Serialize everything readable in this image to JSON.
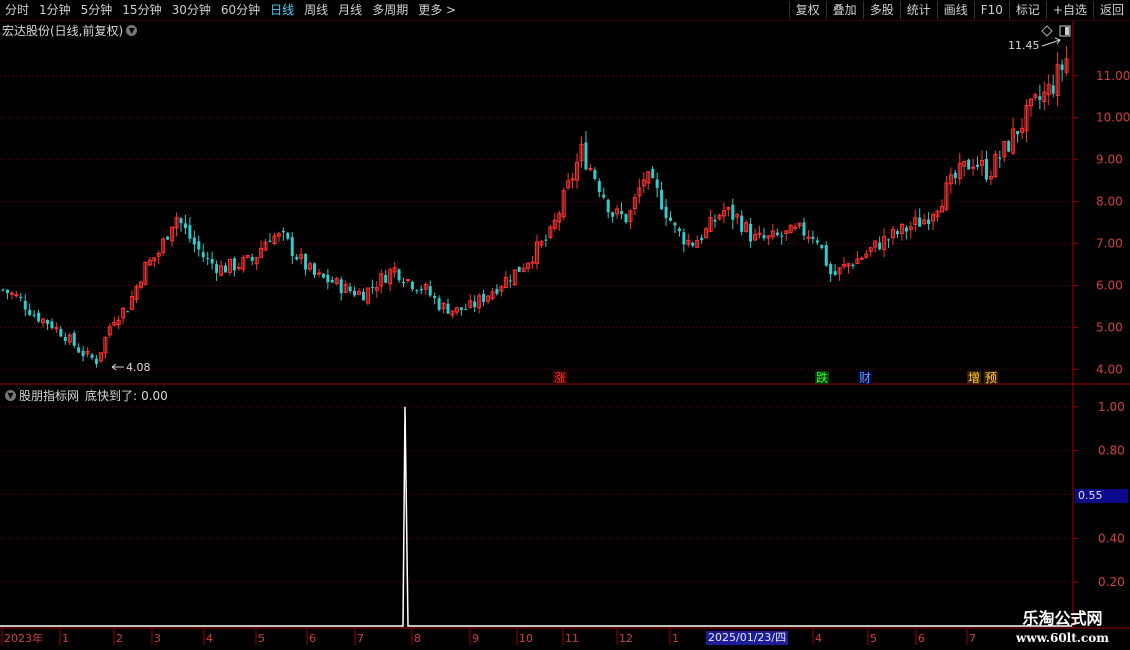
{
  "toolbar": {
    "periods": [
      "分时",
      "1分钟",
      "5分钟",
      "15分钟",
      "30分钟",
      "60分钟",
      "日线",
      "周线",
      "月线",
      "多周期",
      "更多"
    ],
    "active_period": "日线",
    "more_arrow": ">",
    "right_buttons": [
      "复权",
      "叠加",
      "多股",
      "统计",
      "画线",
      "F10",
      "标记",
      "+自选",
      "返回"
    ]
  },
  "main_panel": {
    "title": "宏达股份(日线,前复权)",
    "price_axis": [
      "11.00",
      "10.00",
      "9.00",
      "8.00",
      "7.00",
      "6.00",
      "5.00",
      "4.00"
    ],
    "high_label": "11.45",
    "low_label": "4.08",
    "event_tags": [
      {
        "text": "涨",
        "color": "#ff3030",
        "bg": "#3a0000"
      },
      {
        "text": "跌",
        "color": "#30ff30",
        "bg": "#003a00"
      },
      {
        "text": "财",
        "color": "#5aa0ff",
        "bg": "#000030"
      },
      {
        "text": "增",
        "color": "#ffcc33",
        "bg": "#3a2000"
      },
      {
        "text": "预",
        "color": "#ffcc33",
        "bg": "#3a2000"
      }
    ]
  },
  "sub_panel": {
    "title": "股朋指标网",
    "indicator_label": "底快到了:",
    "indicator_value": "0.00",
    "axis": [
      "1.00",
      "0.80",
      "0.40",
      "0.20"
    ],
    "cursor_value": "0.55",
    "signal_value": 1.0
  },
  "time_axis": {
    "labels": [
      "2023年",
      "1",
      "2",
      "3",
      "4",
      "5",
      "6",
      "7",
      "8",
      "9",
      "10",
      "11",
      "12",
      "1",
      "4",
      "5",
      "6",
      "7"
    ],
    "highlight_date": "2025/01/23/四"
  },
  "watermark": {
    "line1": "乐淘公式网",
    "line2": "www.60lt.com"
  },
  "chart_data": {
    "type": "candlestick",
    "title": "宏达股份(日线,前复权)",
    "ylim": [
      3.7,
      11.9
    ],
    "y_ticks": [
      4,
      5,
      6,
      7,
      8,
      9,
      10,
      11
    ],
    "colors": {
      "up": "#ff3333",
      "down": "#33cccc"
    },
    "close_series": [
      5.9,
      5.7,
      5.3,
      5.1,
      4.8,
      4.4,
      4.2,
      5.2,
      5.5,
      6.4,
      6.8,
      7.7,
      7.1,
      6.6,
      6.4,
      6.5,
      6.6,
      7.2,
      7.1,
      6.6,
      6.2,
      6.1,
      5.9,
      5.8,
      6.1,
      6.4,
      6.1,
      5.9,
      5.5,
      5.4,
      5.5,
      5.8,
      6.1,
      6.4,
      6.8,
      7.2,
      8.2,
      9.2,
      8.5,
      7.7,
      7.6,
      8.6,
      8.1,
      7.3,
      7.0,
      7.3,
      7.8,
      7.6,
      7.1,
      7.1,
      7.2,
      7.3,
      7.2,
      6.2,
      6.5,
      6.7,
      7.0,
      7.2,
      7.4,
      7.6,
      8.1,
      8.6,
      9.0,
      8.7,
      9.2,
      9.8,
      10.3,
      10.7,
      11.4
    ],
    "high": 11.45,
    "low": 4.08
  }
}
